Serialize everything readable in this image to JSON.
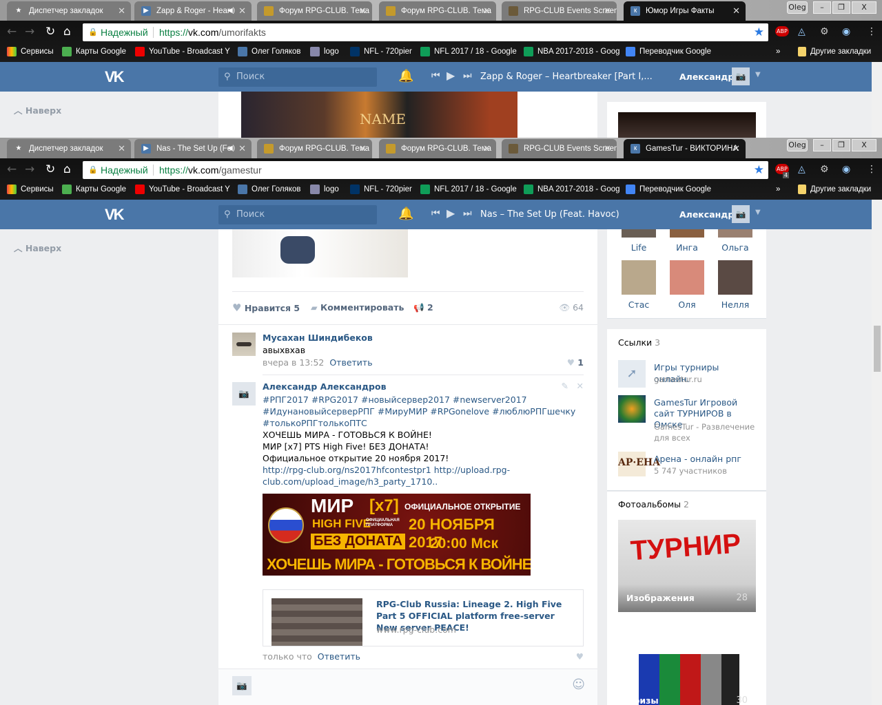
{
  "windows": [
    {
      "tabs": [
        {
          "title": "Диспетчер закладок",
          "icon": "star-icon"
        },
        {
          "title": "Zapp & Roger - Hear",
          "icon": "vk-video-icon",
          "audio": true
        },
        {
          "title": "Форум RPG-CLUB. Тема",
          "icon": "rpg-club-icon"
        },
        {
          "title": "Форум RPG-CLUB. Тема",
          "icon": "rpg-club-icon"
        },
        {
          "title": "RPG-CLUB Events Screen",
          "icon": "rpg-events-icon"
        },
        {
          "title": "Юмор Игры Факты",
          "icon": "vk-icon",
          "active": true
        }
      ],
      "profile": "Oleg",
      "secure_label": "Надежный",
      "url_scheme": "https://",
      "url_host": "vk.com",
      "url_path": "/umorifakts",
      "track": "Zapp & Roger – Heartbreaker [Part I,..."
    },
    {
      "tabs": [
        {
          "title": "Диспетчер закладок",
          "icon": "star-icon"
        },
        {
          "title": "Nas - The Set Up (Fe",
          "icon": "vk-video-icon",
          "audio": true
        },
        {
          "title": "Форум RPG-CLUB. Тема",
          "icon": "rpg-club-icon"
        },
        {
          "title": "Форум RPG-CLUB. Тема",
          "icon": "rpg-club-icon"
        },
        {
          "title": "RPG-CLUB Events Screen",
          "icon": "rpg-events-icon"
        },
        {
          "title": "GamesTur - ВИКТОРИНА",
          "icon": "vk-icon",
          "active": true
        }
      ],
      "profile": "Oleg",
      "secure_label": "Надежный",
      "url_scheme": "https://",
      "url_host": "vk.com",
      "url_path": "/gamestur",
      "track": "Nas – The Set Up (Feat. Havoc)"
    }
  ],
  "bookmarks": [
    "Сервисы",
    "Карты Google",
    "YouTube - Broadcast Y",
    "Олег Голяков",
    "logo",
    "NFL - 720pier",
    "NFL 2017 / 18 - Google",
    "NBA 2017-2018 - Goog",
    "Переводчик Google"
  ],
  "bookmarks_more": "»",
  "other_bookmarks": "Другие закладки",
  "abp_badge": "4",
  "vk": {
    "logo": "VK",
    "search_placeholder": "Поиск",
    "user_name": "Александр",
    "back_to_top": "Наверх",
    "top_banner_text": "NAME"
  },
  "post": {
    "like_label": "Нравится",
    "likes": "5",
    "comment_label": "Комментировать",
    "shares": "2",
    "views": "64"
  },
  "comments": [
    {
      "author": "Мусахан Шиндибеков",
      "text": "авыхвхав",
      "time": "вчера в 13:52",
      "reply": "Ответить",
      "likes": "1"
    },
    {
      "author": "Александр Александров",
      "lines": [
        "#РПГ2017 #RPG2017 #новыйсервер2017 #newserver2017",
        "#ИдунановыйсерверРПГ #МируМИР #RPGonelove #люблюРПГшечку",
        "#толькоРПГтолькоПТС"
      ],
      "text_lines": [
        "ХОЧЕШЬ МИРА - ГОТОВЬСЯ К ВОЙНЕ!",
        "МИР [x7] PTS High Five! БЕЗ ДОНАТА!",
        "Официальное открытие 20 ноября 2017!"
      ],
      "links": [
        "http://rpg-club.org/ns2017hfcontestpr1 http://upload.rpg-",
        "club.com/upload_image/h3_party_1710.."
      ],
      "banner": {
        "title": "МИР",
        "rate": "[x7]",
        "subtitle": "HIGH FIVE",
        "platform": "ОФИЦИАЛЬНАЯ ПЛАТФОРМА",
        "nodonate": "БЕЗ ДОНАТА",
        "opening": "ОФИЦИАЛЬНОЕ ОТКРЫТИЕ",
        "date": "20 НОЯБРЯ 2017",
        "time": "20:00 Мск",
        "slogan": "ХОЧЕШЬ МИРА - ГОТОВЬСЯ К ВОЙНЕ"
      },
      "card": {
        "title": "RPG-Club Russia: Lineage 2. High Five Part 5 OFFICIAL platform free-server New server PEACE!",
        "domain": "www.rpg-club.com"
      },
      "time": "только что",
      "reply": "Ответить"
    }
  ],
  "friends": [
    {
      "name": "Life"
    },
    {
      "name": "Инга"
    },
    {
      "name": "Ольга"
    },
    {
      "name": "Стас",
      "color": "#b9a88c"
    },
    {
      "name": "Оля",
      "color": "#d88a7a"
    },
    {
      "name": "Нелля",
      "color": "#5a4a44"
    }
  ],
  "links_block": {
    "title": "Ссылки",
    "count": "3",
    "items": [
      {
        "title": "Игры турниры онлайн.",
        "sub": "gamestur.ru"
      },
      {
        "title": "GamesTur Игровой сайт ТУРНИРОВ в Омске",
        "sub": "GamesTur - Развлечение для всех"
      },
      {
        "title": "Арена - онлайн рпг",
        "sub": "5 747 участников"
      }
    ]
  },
  "albums": {
    "title": "Фотоальбомы",
    "count": "2",
    "items": [
      {
        "name": "Изображения",
        "count": "28",
        "cover_text": "ТУРНИР"
      },
      {
        "name": "Призы",
        "count": "30"
      }
    ]
  }
}
